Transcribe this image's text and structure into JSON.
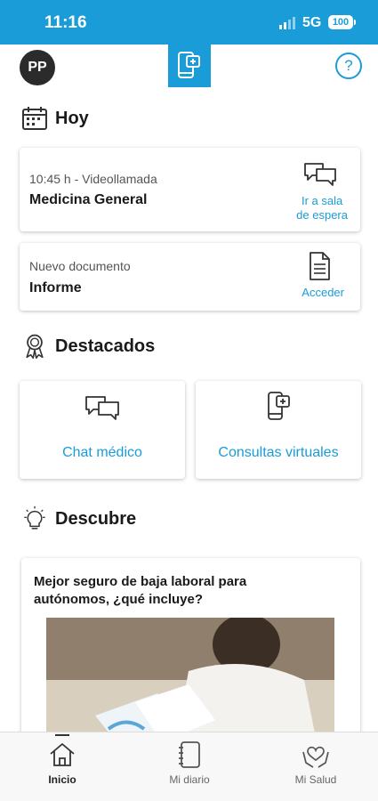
{
  "status_bar": {
    "time": "11:16",
    "network": "5G",
    "battery": "100"
  },
  "topbar": {
    "avatar_initials": "PP",
    "help_symbol": "?"
  },
  "sections": {
    "today": "Hoy",
    "featured": "Destacados",
    "discover": "Descubre"
  },
  "today_cards": [
    {
      "sub": "10:45 h - Videollamada",
      "main": "Medicina General",
      "action_line1": "Ir a sala",
      "action_line2": "de espera",
      "icon": "chat-bubbles-icon"
    },
    {
      "sub": "Nuevo documento",
      "main": "Informe",
      "action_line1": "Acceder",
      "icon": "document-icon"
    }
  ],
  "featured": [
    {
      "label": "Chat médico",
      "icon": "chat-bubbles-icon"
    },
    {
      "label": "Consultas virtuales",
      "icon": "phone-plus-icon"
    }
  ],
  "article": {
    "title": "Mejor seguro de baja laboral para autónomos, ¿qué incluye?"
  },
  "tabbar": [
    {
      "label": "Inicio",
      "icon": "home-icon",
      "active": true
    },
    {
      "label": "Mi diario",
      "icon": "notebook-icon",
      "active": false
    },
    {
      "label": "Mi Salud",
      "icon": "heart-hands-icon",
      "active": false
    }
  ],
  "colors": {
    "accent": "#1a9cd8",
    "text": "#1a1a1a"
  }
}
